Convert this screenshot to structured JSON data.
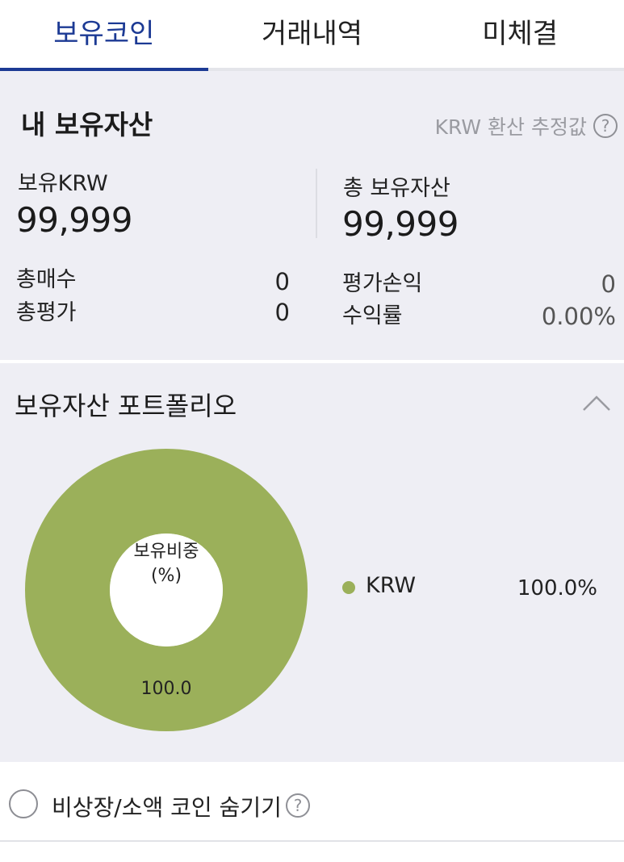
{
  "tabs": [
    {
      "label": "보유코인",
      "active": true
    },
    {
      "label": "거래내역",
      "active": false
    },
    {
      "label": "미체결",
      "active": false
    }
  ],
  "summary": {
    "title": "내 보유자산",
    "estimate_label": "KRW 환산 추정값",
    "help_glyph": "?",
    "krw_label": "보유KRW",
    "krw_value": "99,999",
    "total_label": "총 보유자산",
    "total_value": "99,999",
    "buy_label": "총매수",
    "buy_value": "0",
    "eval_label": "총평가",
    "eval_value": "0",
    "pnl_label": "평가손익",
    "pnl_value": "0",
    "rate_label": "수익률",
    "rate_value": "0.00%"
  },
  "portfolio": {
    "title": "보유자산 포트폴리오",
    "collapse_icon": "chevron-up-icon"
  },
  "chart_data": {
    "type": "pie",
    "center_label_1": "보유비중",
    "center_label_2": "(%)",
    "slices": [
      {
        "name": "KRW",
        "value": 100.0,
        "label": "100.0",
        "legend_pct": "100.0%",
        "color": "#9bb05a"
      }
    ]
  },
  "bottom": {
    "hide_label": "비상장/소액 코인 숨기기",
    "help_glyph": "?"
  },
  "colors": {
    "accent": "#1c3a94",
    "panel_bg": "#eeeef4",
    "krw_green": "#9bb05a"
  }
}
